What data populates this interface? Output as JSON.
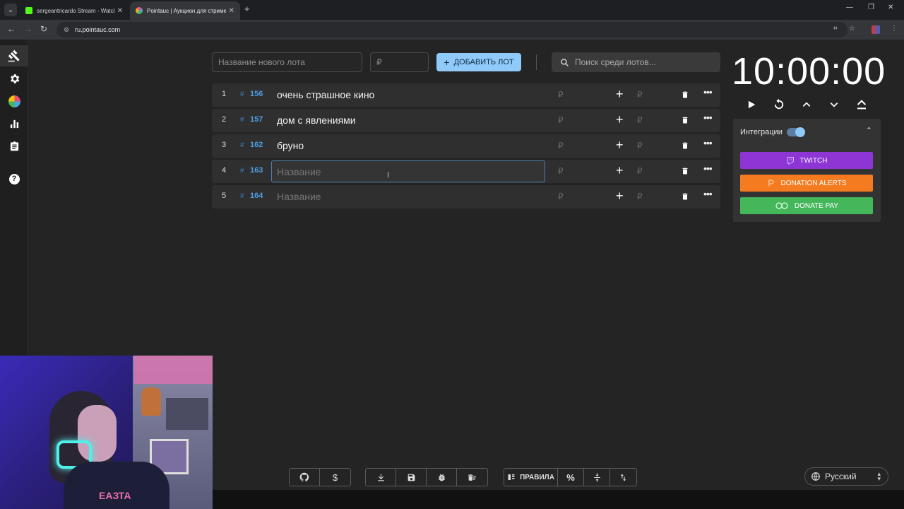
{
  "browser": {
    "tabs": [
      {
        "title": "sergeantricardo Stream - Watch",
        "favicon_color": "#53fc18"
      },
      {
        "title": "Pointauc | Аукцион для стримеров",
        "favicon_color": "#e94e77"
      }
    ],
    "url": "ru.pointauc.com"
  },
  "controls": {
    "new_lot_placeholder": "Название нового лота",
    "currency_placeholder": "₽",
    "add_lot_label": "ДОБАВИТЬ ЛОТ",
    "search_placeholder": "Поиск среди лотов..."
  },
  "lots": [
    {
      "index": "1",
      "id": "156",
      "name": "очень страшное кино",
      "currency": "₽"
    },
    {
      "index": "2",
      "id": "157",
      "name": "дом с явлениями",
      "currency": "₽"
    },
    {
      "index": "3",
      "id": "162",
      "name": "бруно",
      "currency": "₽"
    },
    {
      "index": "4",
      "id": "163",
      "name": "",
      "placeholder": "Название",
      "currency": "₽"
    },
    {
      "index": "5",
      "id": "164",
      "name": "",
      "placeholder": "Название",
      "currency": "₽"
    }
  ],
  "timer": {
    "value": "10:00:00"
  },
  "integrations": {
    "label": "Интеграции",
    "enabled": true,
    "buttons": [
      {
        "label": "TWITCH",
        "color": "#8e35d6"
      },
      {
        "label": "DONATION ALERTS",
        "color": "#f47b20"
      },
      {
        "label": "DONATE PAY",
        "color": "#43b759"
      }
    ]
  },
  "toolbar": {
    "rules_label": "ПРАВИЛА",
    "percent_label": "%"
  },
  "language": {
    "selected": "Русский"
  },
  "accent_color": "#90caf9"
}
